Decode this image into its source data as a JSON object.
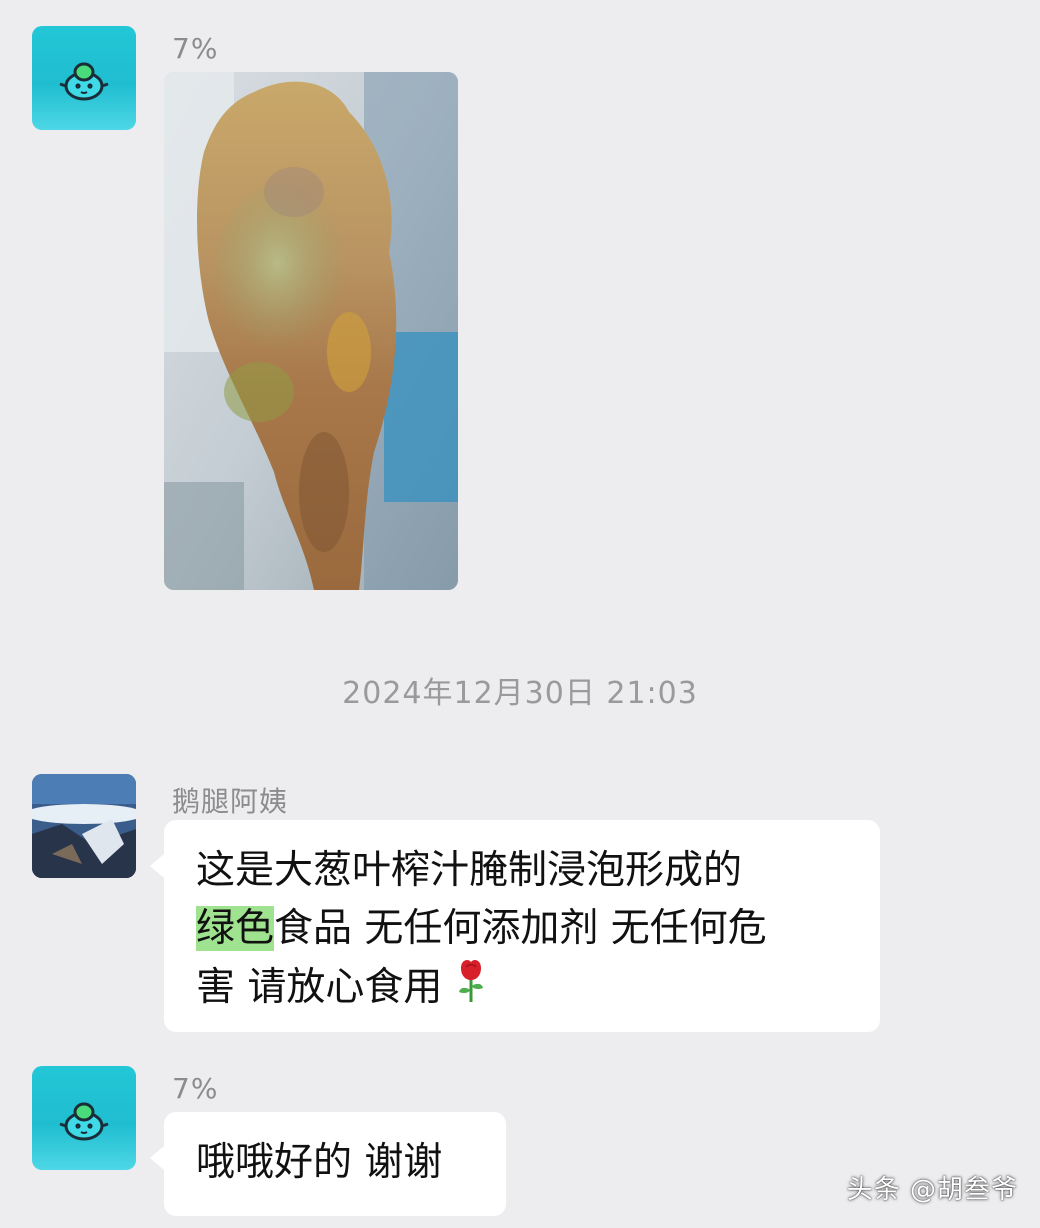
{
  "messages": [
    {
      "sender": "7%",
      "type": "image",
      "image_alt": "fried chicken leg with green mold"
    }
  ],
  "timestamp": "2024年12月30日 21:03",
  "reply": {
    "sender": "鹅腿阿姨",
    "line1": "这是大葱叶榨汁腌制浸泡形成的",
    "highlight": "绿色",
    "line2_rest": "食品 无任何添加剂 无任何危",
    "line3": "害 请放心食用",
    "emoji": "rose-emoji"
  },
  "response": {
    "sender": "7%",
    "text": "哦哦好的 谢谢"
  },
  "watermark": "头条 @胡叁爷",
  "colors": {
    "background": "#ededf0",
    "bubble": "#ffffff",
    "highlight": "#9fe28f",
    "name": "#8c8c8c",
    "timestamp": "#9a9a9a"
  }
}
